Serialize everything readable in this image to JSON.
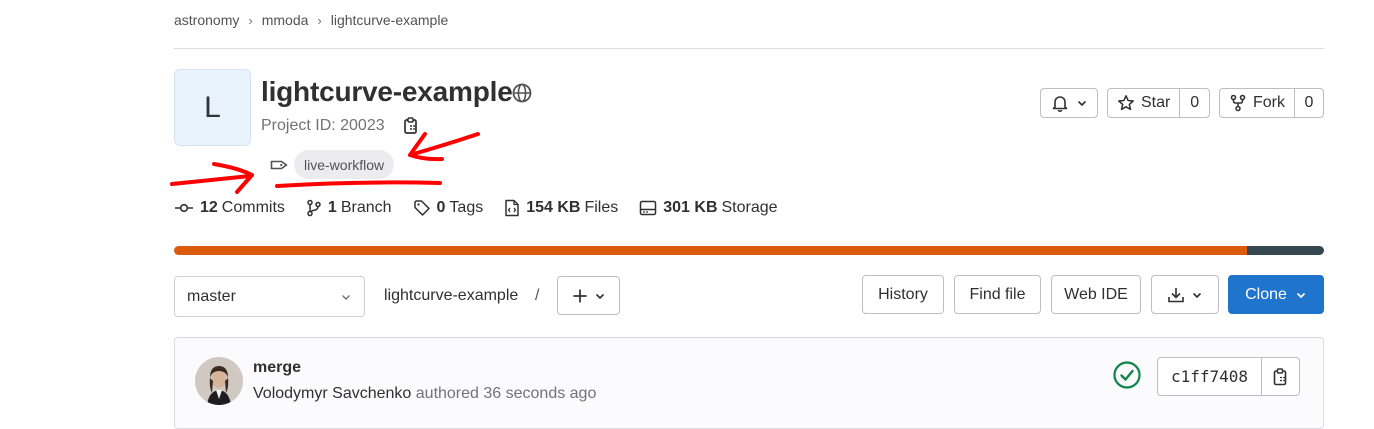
{
  "breadcrumb": {
    "items": [
      "astronomy",
      "mmoda",
      "lightcurve-example"
    ],
    "separator": "›"
  },
  "project": {
    "avatar_letter": "L",
    "title": "lightcurve-example",
    "visibility_icon": "globe-icon",
    "id_text": "Project ID: 20023",
    "topic": "live-workflow"
  },
  "actions": {
    "notification_icon": "bell-icon",
    "star_label": "Star",
    "star_count": "0",
    "fork_label": "Fork",
    "fork_count": "0"
  },
  "stats": [
    {
      "icon": "commit-icon",
      "value": "12",
      "label": "Commits"
    },
    {
      "icon": "branch-icon",
      "value": "1",
      "label": "Branch"
    },
    {
      "icon": "label-icon",
      "value": "0",
      "label": "Tags"
    },
    {
      "icon": "doc-code-icon",
      "value": "154 KB",
      "label": "Files"
    },
    {
      "icon": "disk-icon",
      "value": "301 KB",
      "label": "Storage"
    }
  ],
  "languages": [
    {
      "share": 0.933,
      "color": "#da5b0b"
    },
    {
      "share": 0.067,
      "color": "#37474f"
    }
  ],
  "repo": {
    "branch": "master",
    "path": "lightcurve-example",
    "path_sep": "/",
    "history_label": "History",
    "find_file_label": "Find file",
    "web_ide_label": "Web IDE",
    "clone_label": "Clone"
  },
  "commit": {
    "message": "merge",
    "author": "Volodymyr Savchenko",
    "authored_text": "authored 36 seconds ago",
    "sha": "c1ff7408",
    "status": "passed"
  },
  "colors": {
    "accent": "#1f75cb",
    "success": "#108548",
    "annotation": "#ff0000"
  }
}
